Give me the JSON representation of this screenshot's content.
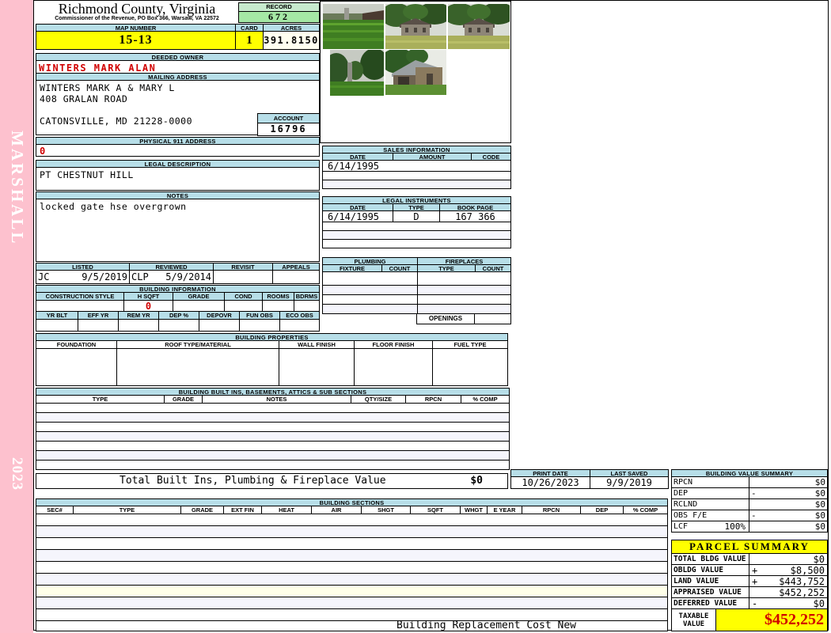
{
  "sidebar": {
    "vertical_top": "MARSHALL",
    "vertical_bottom": "2023"
  },
  "header": {
    "county_title": "Richmond County, Virginia",
    "subtitle": "Commissioner of the Revenue, PO Box 366, Warsaw, VA 22572",
    "record": {
      "label": "RECORD",
      "value": "672"
    },
    "map_number": {
      "label": "MAP NUMBER",
      "value": "15-13"
    },
    "card": {
      "label": "CARD",
      "value": "1"
    },
    "acres": {
      "label": "ACRES",
      "value": "391.8150"
    }
  },
  "owner": {
    "deeded_owner_label": "DEEDED OWNER",
    "deeded_owner": "WINTERS MARK ALAN",
    "mailing_label": "MAILING ADDRESS",
    "mailing_lines": [
      "WINTERS MARK A & MARY L",
      "408 GRALAN ROAD",
      "",
      "CATONSVILLE, MD 21228-0000"
    ],
    "account_label": "ACCOUNT",
    "account": "16796",
    "physical_label": "PHYSICAL 911 ADDRESS",
    "physical_address": "0",
    "legal_label": "LEGAL DESCRIPTION",
    "legal_description": "PT CHESTNUT HILL",
    "notes_label": "NOTES",
    "notes": "locked gate hse overgrown"
  },
  "photos": {
    "names": [
      "corn-field-photo",
      "farmhouse-photo-1",
      "farmhouse-photo-2",
      "chimney-trees-photo",
      "barn-photo"
    ]
  },
  "review": {
    "columns": [
      "LISTED",
      "REVIEWED",
      "REVISIT",
      "APPEALS"
    ],
    "listed_by": "JC",
    "listed_date": "9/5/2019",
    "reviewed_by": "CLP",
    "reviewed_date": "5/9/2014",
    "revisit": "",
    "appeals": ""
  },
  "building_information": {
    "title": "BUILDING INFORMATION",
    "row1_columns": [
      "CONSTRUCTION STYLE",
      "H SQFT",
      "GRADE",
      "COND",
      "ROOMS",
      "BDRMS"
    ],
    "h_sqft": "0",
    "row2_columns": [
      "YR BLT",
      "EFF YR",
      "REM YR",
      "DEP %",
      "DEPOVR",
      "FUN OBS",
      "ECO OBS"
    ]
  },
  "sales": {
    "title": "SALES INFORMATION",
    "columns": [
      "DATE",
      "AMOUNT",
      "CODE"
    ],
    "rows": [
      {
        "date": "6/14/1995",
        "amount": "",
        "code": ""
      }
    ]
  },
  "legal_instruments": {
    "title": "LEGAL INSTRUMENTS",
    "columns": [
      "DATE",
      "TYPE",
      "BOOK PAGE"
    ],
    "rows": [
      {
        "date": "6/14/1995",
        "type": "D",
        "book_page": "167 366"
      }
    ]
  },
  "plumbing_fireplaces": {
    "plumbing_title": "PLUMBING",
    "fireplaces_title": "FIREPLACES",
    "columns": [
      "FIXTURE",
      "COUNT",
      "TYPE",
      "COUNT"
    ],
    "openings_label": "OPENINGS"
  },
  "building_properties": {
    "title": "BUILDING PROPERTIES",
    "columns": [
      "FOUNDATION",
      "ROOF TYPE/MATERIAL",
      "WALL FINISH",
      "FLOOR FINISH",
      "FUEL TYPE"
    ]
  },
  "built_ins": {
    "title": "BUILDING BUILT INS, BASEMENTS, ATTICS & SUB SECTIONS",
    "columns": [
      "TYPE",
      "GRADE",
      "NOTES",
      "QTY/SIZE",
      "RPCN",
      "% COMP"
    ],
    "total_label": "Total Built Ins, Plumbing & Fireplace Value",
    "total_value": "$0"
  },
  "print_info": {
    "print_date_label": "PRINT DATE",
    "print_date": "10/26/2023",
    "last_saved_label": "LAST SAVED",
    "last_saved": "9/9/2019"
  },
  "building_value_summary": {
    "title": "BUILDING VALUE SUMMARY",
    "rows": [
      {
        "label": "RPCN",
        "op": "",
        "value": "$0"
      },
      {
        "label": "DEP",
        "op": "-",
        "value": "$0"
      },
      {
        "label": "RCLND",
        "op": "",
        "value": "$0"
      },
      {
        "label": "OBS F/E",
        "op": "-",
        "value": "$0"
      },
      {
        "label": "LCF",
        "pct": "100%",
        "op": "",
        "value": "$0"
      }
    ]
  },
  "building_sections": {
    "title": "BUILDING SECTIONS",
    "columns": [
      "SEC#",
      "TYPE",
      "GRADE",
      "EXT FIN",
      "HEAT",
      "AIR",
      "SHGT",
      "SQFT",
      "WHGT",
      "E YEAR",
      "RPCN",
      "DEP",
      "% COMP"
    ],
    "footer": "Building Replacement Cost New"
  },
  "parcel_summary": {
    "title": "PARCEL SUMMARY",
    "rows": [
      {
        "label": "TOTAL BLDG VALUE",
        "op": "",
        "value": "$0"
      },
      {
        "label": "OBLDG VALUE",
        "op": "+",
        "value": "$8,500"
      },
      {
        "label": "LAND VALUE",
        "op": "+",
        "value": "$443,752"
      },
      {
        "label": "APPRAISED VALUE",
        "op": "",
        "value": "$452,252"
      },
      {
        "label": "DEFERRED VALUE",
        "op": "-",
        "value": "$0"
      }
    ],
    "taxable_label": "TAXABLE VALUE",
    "taxable_value": "$452,252"
  },
  "colors": {
    "accent_blue": "#B7DEE8",
    "record_green": "#A5E8A5",
    "highlight_yellow": "#FFFF00",
    "sidebar_pink": "#FDC1CE",
    "alert_red": "#D00000"
  }
}
